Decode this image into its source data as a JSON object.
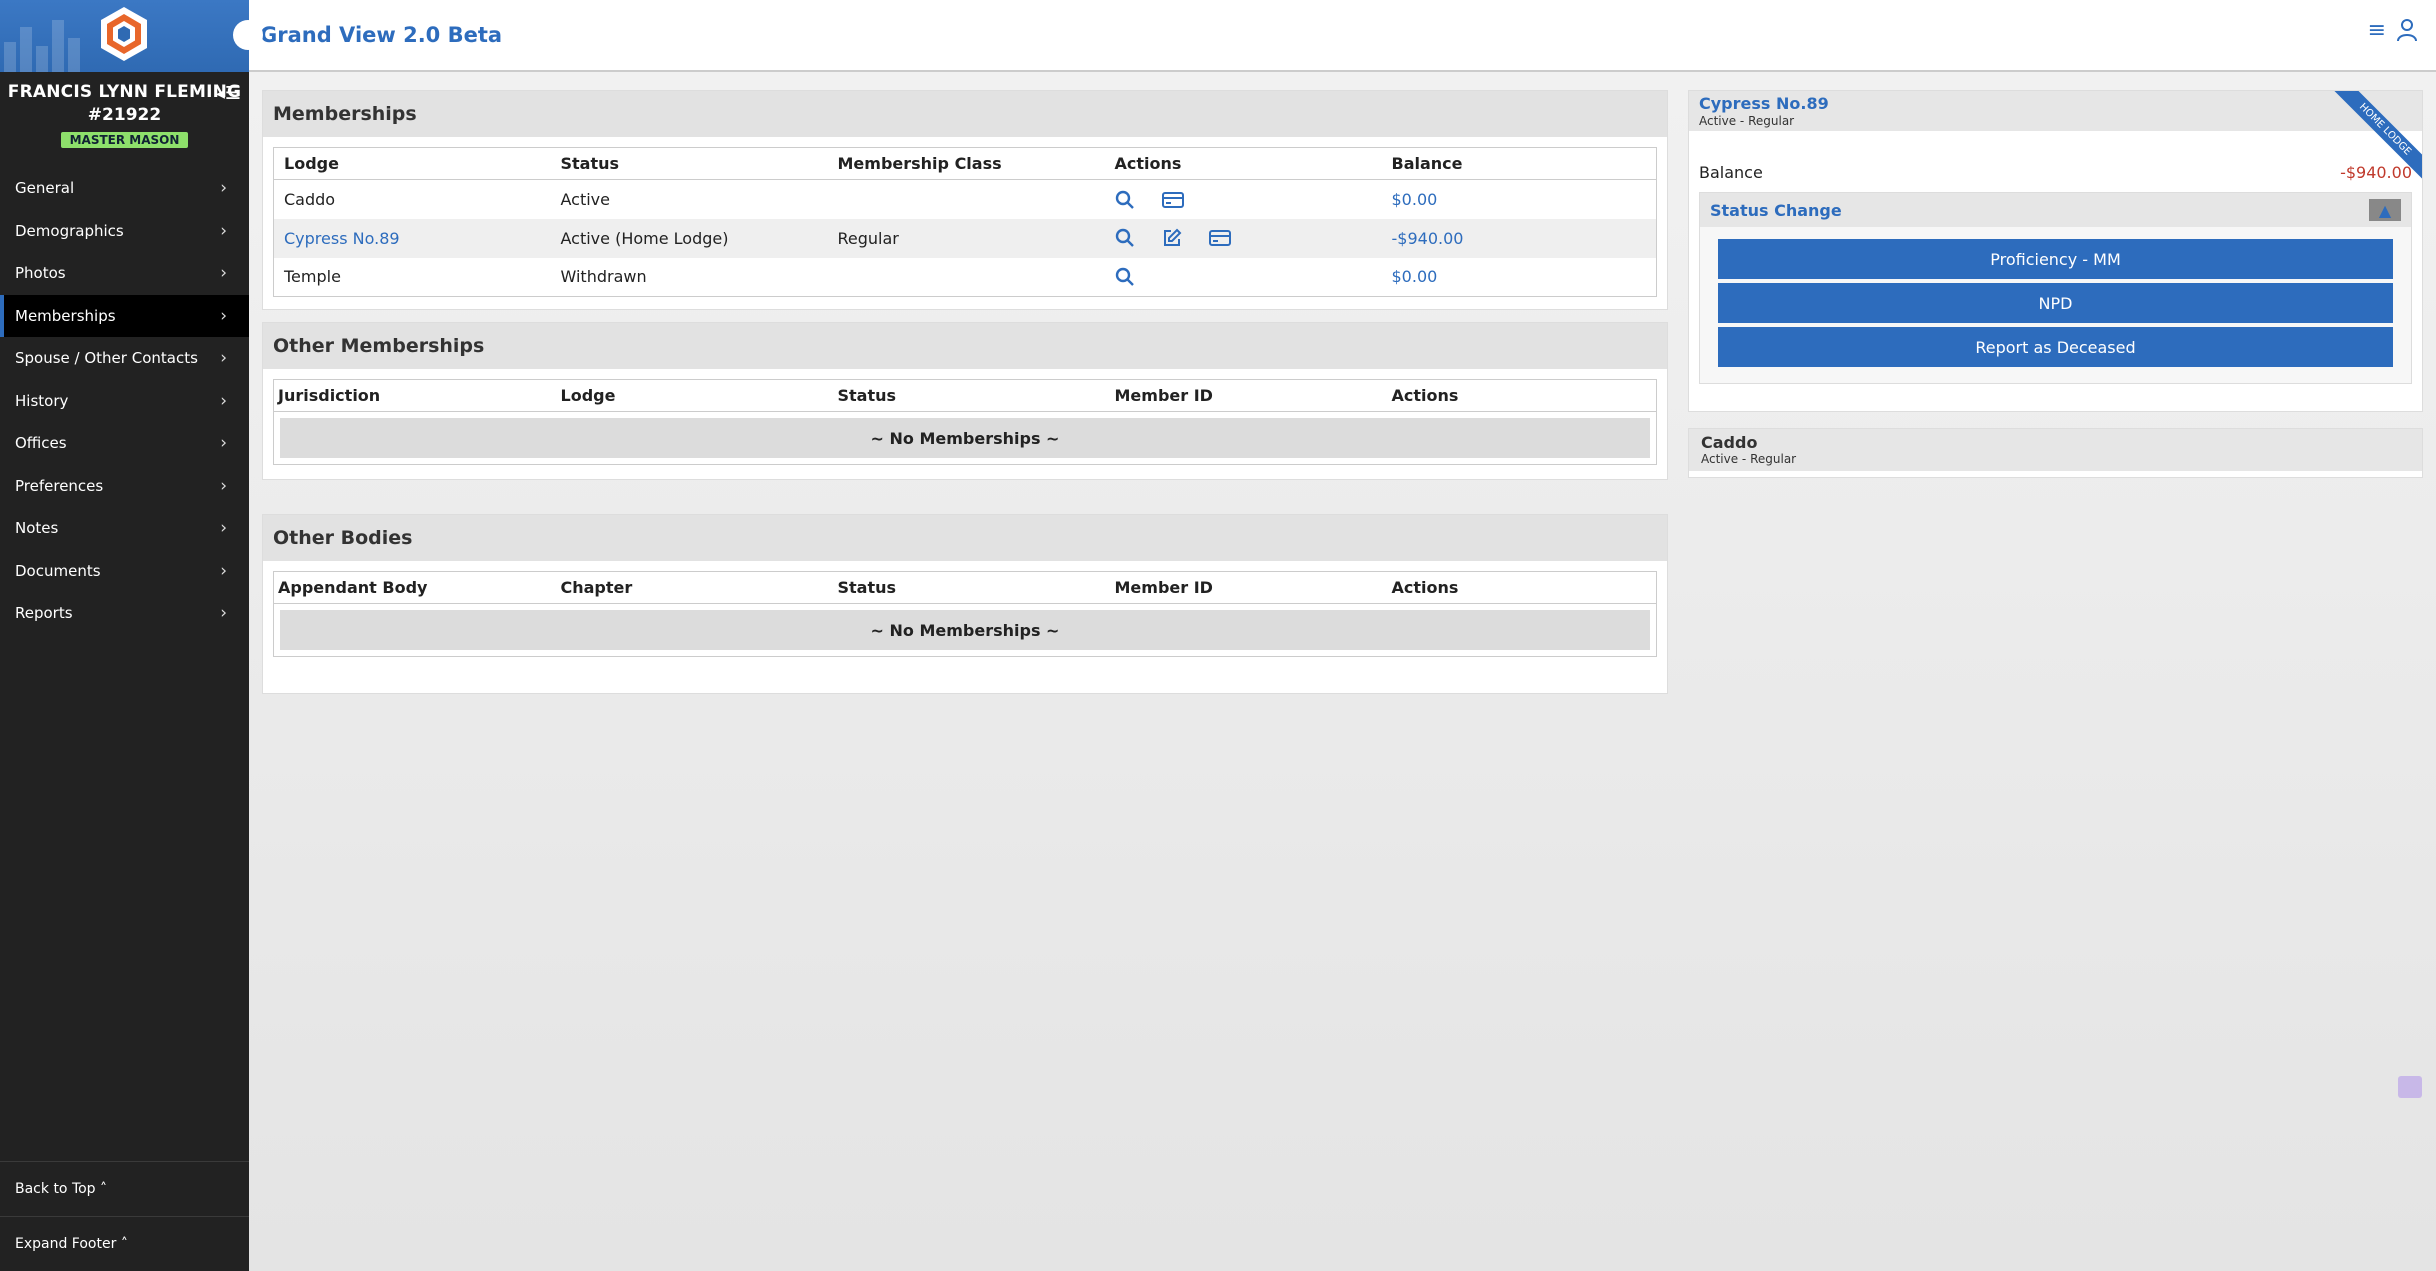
{
  "app": {
    "title": "Grand View 2.0 Beta"
  },
  "profile": {
    "name": "FRANCIS LYNN FLEMING",
    "number": "#21922",
    "degree": "MASTER MASON"
  },
  "nav": [
    {
      "label": "General"
    },
    {
      "label": "Demographics"
    },
    {
      "label": "Photos"
    },
    {
      "label": "Memberships",
      "active": true
    },
    {
      "label": "Spouse / Other Contacts"
    },
    {
      "label": "History"
    },
    {
      "label": "Offices"
    },
    {
      "label": "Preferences"
    },
    {
      "label": "Notes"
    },
    {
      "label": "Documents"
    },
    {
      "label": "Reports"
    }
  ],
  "sidebar_footer": {
    "back_to_top": "Back to Top",
    "expand_footer": "Expand Footer"
  },
  "memberships": {
    "title": "Memberships",
    "columns": [
      "Lodge",
      "Status",
      "Membership Class",
      "Actions",
      "Balance"
    ],
    "rows": [
      {
        "lodge": "Caddo",
        "status": "Active",
        "class": "",
        "balance": "$0.00"
      },
      {
        "lodge": "Cypress No.89",
        "status": "Active  (Home Lodge)",
        "class": "Regular",
        "balance": "-$940.00"
      },
      {
        "lodge": "Temple",
        "status": "Withdrawn",
        "class": "",
        "balance": "$0.00"
      }
    ]
  },
  "other_memberships": {
    "title": "Other Memberships",
    "columns": [
      "Jurisdiction",
      "Lodge",
      "Status",
      "Member ID",
      "Actions"
    ],
    "empty": "~ No Memberships ~"
  },
  "other_bodies": {
    "title": "Other Bodies",
    "columns": [
      "Appendant Body",
      "Chapter",
      "Status",
      "Member ID",
      "Actions"
    ],
    "empty": "~ No Memberships ~"
  },
  "lodge_card": {
    "name": "Cypress No.89",
    "subtitle": "Active  - Regular",
    "ribbon": "HOME LODGE",
    "balance_label": "Balance",
    "balance_value": "-$940.00",
    "status_change": {
      "title": "Status Change",
      "buttons": [
        "Proficiency - MM",
        "NPD",
        "Report as Deceased"
      ]
    }
  },
  "caddo_card": {
    "name": "Caddo",
    "subtitle": "Active  - Regular"
  },
  "colors": {
    "primary": "#2d6cbd",
    "sidebar": "#222222",
    "badge": "#8ee06b",
    "negative": "#c0392b"
  }
}
